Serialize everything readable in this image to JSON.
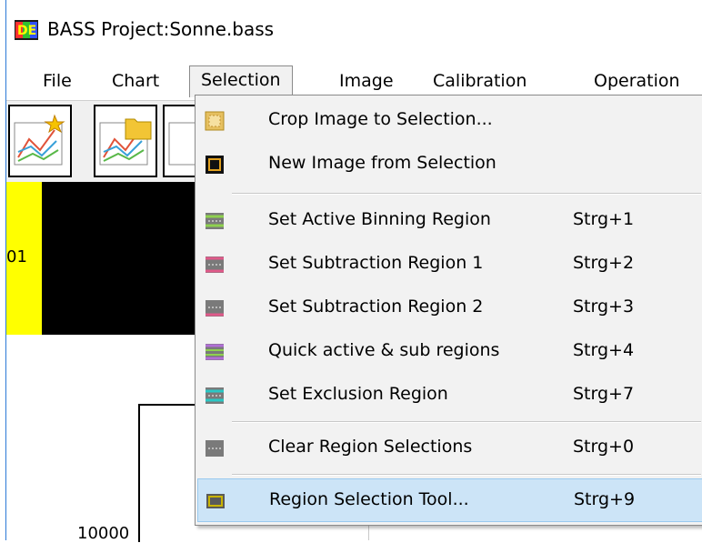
{
  "window": {
    "title": "BASS Project:Sonne.bass"
  },
  "menubar": {
    "items": [
      {
        "label": "File"
      },
      {
        "label": "Chart"
      },
      {
        "label": "Selection"
      },
      {
        "label": "Image"
      },
      {
        "label": "Calibration"
      },
      {
        "label": "Operation"
      }
    ]
  },
  "image_strip": {
    "row_label": "01"
  },
  "chart": {
    "tick_label": "10000"
  },
  "selection_menu": {
    "items": [
      {
        "label": "Crop Image to Selection...",
        "shortcut": "",
        "icon": "crop-icon"
      },
      {
        "label": "New Image from Selection",
        "shortcut": "",
        "icon": "new-image-icon"
      },
      {
        "label": "Set Active Binning Region",
        "shortcut": "Strg+1",
        "icon": "binning-region-icon",
        "color": "#8fd14f"
      },
      {
        "label": "Set Subtraction Region 1",
        "shortcut": "Strg+2",
        "icon": "subtraction-region-1-icon",
        "color": "#e05a8a"
      },
      {
        "label": "Set Subtraction Region 2",
        "shortcut": "Strg+3",
        "icon": "subtraction-region-2-icon",
        "color": "#e05a8a"
      },
      {
        "label": "Quick active & sub regions",
        "shortcut": "Strg+4",
        "icon": "quick-regions-icon",
        "color": "#b16fd6"
      },
      {
        "label": "Set Exclusion Region",
        "shortcut": "Strg+7",
        "icon": "exclusion-region-icon",
        "color": "#2bc7c4"
      },
      {
        "label": "Clear Region Selections",
        "shortcut": "Strg+0",
        "icon": "clear-regions-icon",
        "color": "#888888"
      },
      {
        "label": "Region Selection Tool...",
        "shortcut": "Strg+9",
        "icon": "region-tool-icon",
        "color": "#c9b400"
      }
    ],
    "highlighted_index": 8
  }
}
